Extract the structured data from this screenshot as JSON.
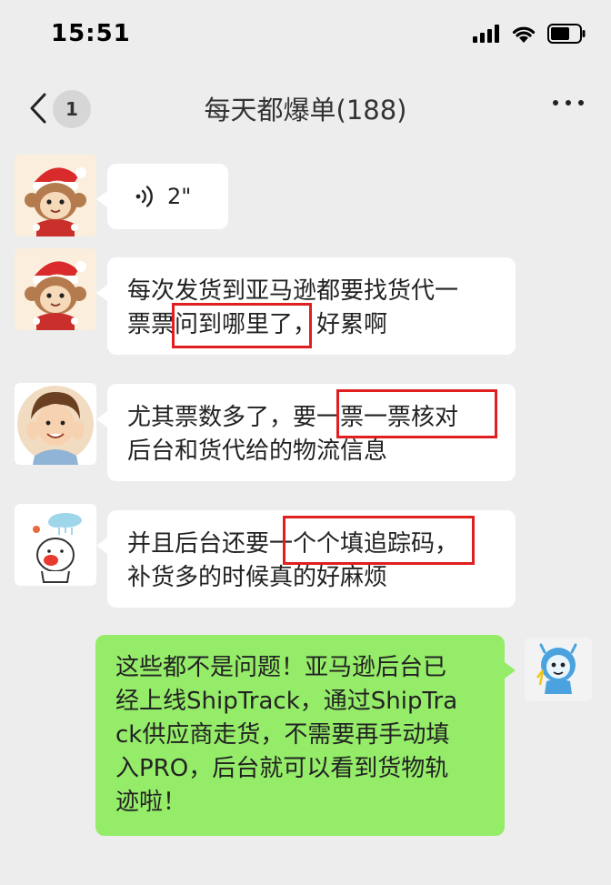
{
  "status_bar": {
    "time": "15:51"
  },
  "nav": {
    "unread_count": "1",
    "title": "每天都爆单(188)"
  },
  "messages": [
    {
      "sender": "monkey-avatar",
      "type": "voice",
      "duration": "2\""
    },
    {
      "sender": "monkey-avatar",
      "type": "text",
      "lines": [
        "每次发货到亚马逊都要找货代一",
        "票票问到哪里了，好累啊"
      ],
      "highlight": "问到哪里了"
    },
    {
      "sender": "boy-avatar",
      "type": "text",
      "lines": [
        "尤其票数多了，要一票一票核对",
        "后台和货代给的物流信息"
      ],
      "highlight": "一票一票核对"
    },
    {
      "sender": "cloud-avatar",
      "type": "text",
      "lines": [
        "并且后台还要一个个填追踪码，",
        "补货多的时候真的好麻烦"
      ],
      "highlight": "一个个填追踪码"
    },
    {
      "sender": "self",
      "type": "text",
      "lines": [
        "这些都不是问题！亚马逊后台已",
        "经上线ShipTrack，通过ShipTra",
        "ck供应商走货，不需要再手动填",
        "入PRO，后台就可以看到货物轨",
        "迹啦！"
      ]
    }
  ],
  "colors": {
    "background": "#ededed",
    "bubble_in": "#ffffff",
    "bubble_out": "#95ec69",
    "highlight": "#e02020"
  }
}
